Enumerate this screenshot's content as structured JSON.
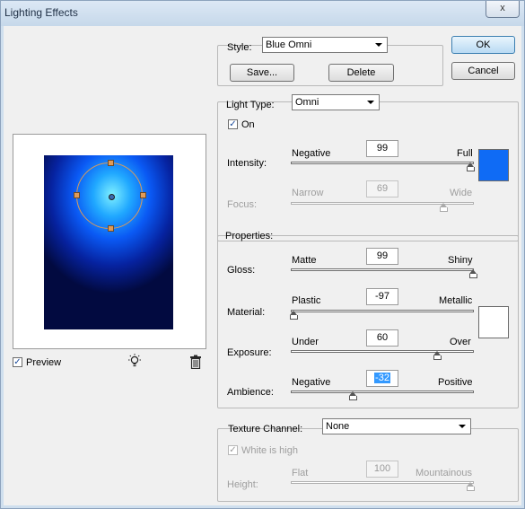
{
  "window": {
    "title": "Lighting Effects",
    "close_glyph": "x"
  },
  "preview": {
    "checkbox_label": "Preview",
    "checked": true,
    "light_icon": "lightbulb-icon",
    "trash_icon": "trash-icon"
  },
  "style": {
    "label": "Style:",
    "value": "Blue Omni",
    "save_label": "Save...",
    "delete_label": "Delete"
  },
  "buttons": {
    "ok": "OK",
    "cancel": "Cancel"
  },
  "light_type": {
    "label": "Light Type:",
    "value": "Omni",
    "on_label": "On",
    "on_checked": true,
    "color": "#0f6bf5",
    "intensity": {
      "label": "Intensity:",
      "min_label": "Negative",
      "max_label": "Full",
      "value": "99"
    },
    "focus": {
      "label": "Focus:",
      "min_label": "Narrow",
      "max_label": "Wide",
      "value": "69",
      "disabled": true
    }
  },
  "properties": {
    "label": "Properties:",
    "color": "#ffffff",
    "gloss": {
      "label": "Gloss:",
      "min_label": "Matte",
      "max_label": "Shiny",
      "value": "99"
    },
    "material": {
      "label": "Material:",
      "min_label": "Plastic",
      "max_label": "Metallic",
      "value": "-97"
    },
    "exposure": {
      "label": "Exposure:",
      "min_label": "Under",
      "max_label": "Over",
      "value": "60"
    },
    "ambience": {
      "label": "Ambience:",
      "min_label": "Negative",
      "max_label": "Positive",
      "value": "-32"
    }
  },
  "texture": {
    "label": "Texture Channel:",
    "value": "None",
    "white_is_high_label": "White is high",
    "white_is_high_checked": true,
    "height": {
      "label": "Height:",
      "min_label": "Flat",
      "max_label": "Mountainous",
      "value": "100",
      "disabled": true
    }
  }
}
